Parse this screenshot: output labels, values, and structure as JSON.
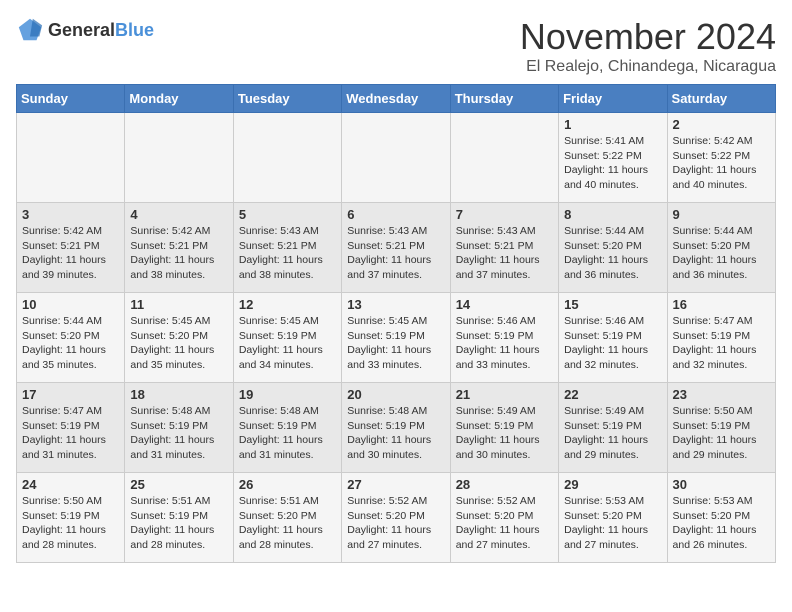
{
  "header": {
    "logo_general": "General",
    "logo_blue": "Blue",
    "title": "November 2024",
    "subtitle": "El Realejo, Chinandega, Nicaragua"
  },
  "weekdays": [
    "Sunday",
    "Monday",
    "Tuesday",
    "Wednesday",
    "Thursday",
    "Friday",
    "Saturday"
  ],
  "weeks": [
    [
      {
        "day": "",
        "info": ""
      },
      {
        "day": "",
        "info": ""
      },
      {
        "day": "",
        "info": ""
      },
      {
        "day": "",
        "info": ""
      },
      {
        "day": "",
        "info": ""
      },
      {
        "day": "1",
        "info": "Sunrise: 5:41 AM\nSunset: 5:22 PM\nDaylight: 11 hours and 40 minutes."
      },
      {
        "day": "2",
        "info": "Sunrise: 5:42 AM\nSunset: 5:22 PM\nDaylight: 11 hours and 40 minutes."
      }
    ],
    [
      {
        "day": "3",
        "info": "Sunrise: 5:42 AM\nSunset: 5:21 PM\nDaylight: 11 hours and 39 minutes."
      },
      {
        "day": "4",
        "info": "Sunrise: 5:42 AM\nSunset: 5:21 PM\nDaylight: 11 hours and 38 minutes."
      },
      {
        "day": "5",
        "info": "Sunrise: 5:43 AM\nSunset: 5:21 PM\nDaylight: 11 hours and 38 minutes."
      },
      {
        "day": "6",
        "info": "Sunrise: 5:43 AM\nSunset: 5:21 PM\nDaylight: 11 hours and 37 minutes."
      },
      {
        "day": "7",
        "info": "Sunrise: 5:43 AM\nSunset: 5:21 PM\nDaylight: 11 hours and 37 minutes."
      },
      {
        "day": "8",
        "info": "Sunrise: 5:44 AM\nSunset: 5:20 PM\nDaylight: 11 hours and 36 minutes."
      },
      {
        "day": "9",
        "info": "Sunrise: 5:44 AM\nSunset: 5:20 PM\nDaylight: 11 hours and 36 minutes."
      }
    ],
    [
      {
        "day": "10",
        "info": "Sunrise: 5:44 AM\nSunset: 5:20 PM\nDaylight: 11 hours and 35 minutes."
      },
      {
        "day": "11",
        "info": "Sunrise: 5:45 AM\nSunset: 5:20 PM\nDaylight: 11 hours and 35 minutes."
      },
      {
        "day": "12",
        "info": "Sunrise: 5:45 AM\nSunset: 5:19 PM\nDaylight: 11 hours and 34 minutes."
      },
      {
        "day": "13",
        "info": "Sunrise: 5:45 AM\nSunset: 5:19 PM\nDaylight: 11 hours and 33 minutes."
      },
      {
        "day": "14",
        "info": "Sunrise: 5:46 AM\nSunset: 5:19 PM\nDaylight: 11 hours and 33 minutes."
      },
      {
        "day": "15",
        "info": "Sunrise: 5:46 AM\nSunset: 5:19 PM\nDaylight: 11 hours and 32 minutes."
      },
      {
        "day": "16",
        "info": "Sunrise: 5:47 AM\nSunset: 5:19 PM\nDaylight: 11 hours and 32 minutes."
      }
    ],
    [
      {
        "day": "17",
        "info": "Sunrise: 5:47 AM\nSunset: 5:19 PM\nDaylight: 11 hours and 31 minutes."
      },
      {
        "day": "18",
        "info": "Sunrise: 5:48 AM\nSunset: 5:19 PM\nDaylight: 11 hours and 31 minutes."
      },
      {
        "day": "19",
        "info": "Sunrise: 5:48 AM\nSunset: 5:19 PM\nDaylight: 11 hours and 31 minutes."
      },
      {
        "day": "20",
        "info": "Sunrise: 5:48 AM\nSunset: 5:19 PM\nDaylight: 11 hours and 30 minutes."
      },
      {
        "day": "21",
        "info": "Sunrise: 5:49 AM\nSunset: 5:19 PM\nDaylight: 11 hours and 30 minutes."
      },
      {
        "day": "22",
        "info": "Sunrise: 5:49 AM\nSunset: 5:19 PM\nDaylight: 11 hours and 29 minutes."
      },
      {
        "day": "23",
        "info": "Sunrise: 5:50 AM\nSunset: 5:19 PM\nDaylight: 11 hours and 29 minutes."
      }
    ],
    [
      {
        "day": "24",
        "info": "Sunrise: 5:50 AM\nSunset: 5:19 PM\nDaylight: 11 hours and 28 minutes."
      },
      {
        "day": "25",
        "info": "Sunrise: 5:51 AM\nSunset: 5:19 PM\nDaylight: 11 hours and 28 minutes."
      },
      {
        "day": "26",
        "info": "Sunrise: 5:51 AM\nSunset: 5:20 PM\nDaylight: 11 hours and 28 minutes."
      },
      {
        "day": "27",
        "info": "Sunrise: 5:52 AM\nSunset: 5:20 PM\nDaylight: 11 hours and 27 minutes."
      },
      {
        "day": "28",
        "info": "Sunrise: 5:52 AM\nSunset: 5:20 PM\nDaylight: 11 hours and 27 minutes."
      },
      {
        "day": "29",
        "info": "Sunrise: 5:53 AM\nSunset: 5:20 PM\nDaylight: 11 hours and 27 minutes."
      },
      {
        "day": "30",
        "info": "Sunrise: 5:53 AM\nSunset: 5:20 PM\nDaylight: 11 hours and 26 minutes."
      }
    ]
  ]
}
